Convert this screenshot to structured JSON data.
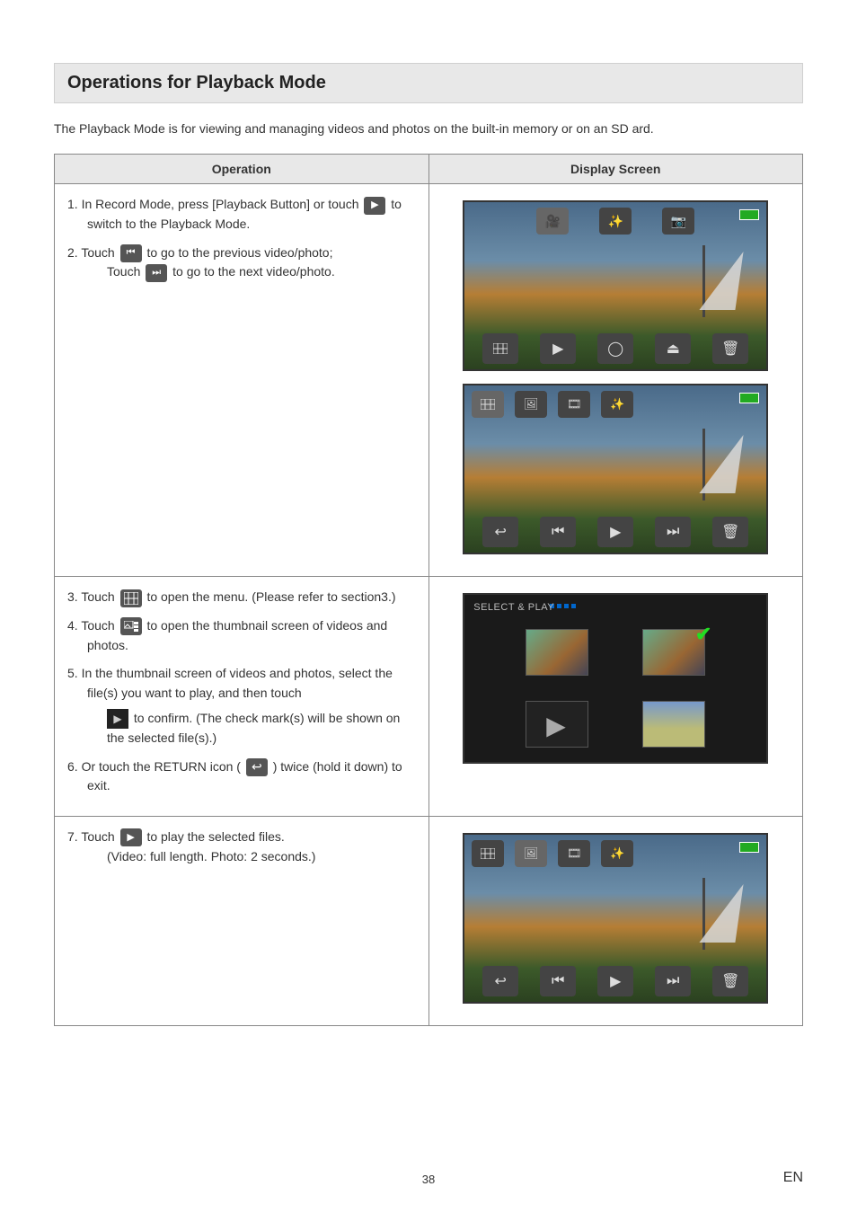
{
  "section_title": "Operations for Playback Mode",
  "intro": "The Playback Mode is for viewing and managing videos and photos on the built-in memory or on an SD ard.",
  "table": {
    "header_operation": "Operation",
    "header_display": "Display Screen"
  },
  "steps": {
    "s1_pre": "1.  In Record Mode, press [Playback Button] or touch ",
    "s1_post": " to switch to the Playback Mode.",
    "s2_pre": "2.  Touch ",
    "s2_mid": " to go to the previous video/photo;",
    "s2_line2_pre": "Touch ",
    "s2_line2_post": " to go to the next video/photo.",
    "s3_pre": "3.  Touch ",
    "s3_post": " to open the menu. (Please refer to section3.)",
    "s4_pre": "4.  Touch ",
    "s4_post": " to open the thumbnail screen of videos and photos.",
    "s5": "5.  In the thumbnail screen of videos and photos, select the file(s) you want to play, and then touch",
    "s5b": " to confirm. (The check mark(s) will be shown on the selected file(s).)",
    "s6_pre": "6.  Or touch the RETURN icon ( ",
    "s6_post": " ) twice (hold it down) to exit.",
    "s7_pre": "7.  Touch ",
    "s7_post": " to play the selected files.",
    "s7_line2": "(Video: full length. Photo: 2 seconds.)"
  },
  "selplay_label": "SELECT & PLAY",
  "page_number": "38",
  "lang": "EN"
}
